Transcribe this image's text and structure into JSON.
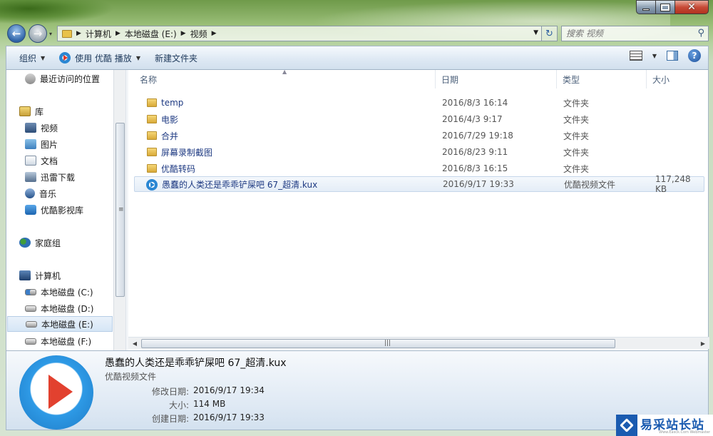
{
  "window": {
    "caption_buttons": [
      "minimize",
      "maximize",
      "close"
    ]
  },
  "address": {
    "crumbs": [
      "计算机",
      "本地磁盘 (E:)",
      "视频"
    ],
    "search_placeholder": "搜索 视频"
  },
  "toolbar": {
    "organize": "组织",
    "play": "使用 优酷 播放",
    "new_folder": "新建文件夹"
  },
  "nav": {
    "recent": "最近访问的位置",
    "library": "库",
    "lib_items": [
      "视频",
      "图片",
      "文档",
      "迅雷下载",
      "音乐",
      "优酷影视库"
    ],
    "homegroup": "家庭组",
    "computer": "计算机",
    "drives": [
      "本地磁盘 (C:)",
      "本地磁盘 (D:)",
      "本地磁盘 (E:)",
      "本地磁盘 (F:)"
    ],
    "selected_drive": "本地磁盘 (E:)"
  },
  "columns": {
    "name": "名称",
    "date": "日期",
    "type": "类型",
    "size": "大小"
  },
  "files": [
    {
      "name": "temp",
      "date": "2016/8/3 16:14",
      "type": "文件夹",
      "size": "",
      "icon": "folder-icon"
    },
    {
      "name": "电影",
      "date": "2016/4/3 9:17",
      "type": "文件夹",
      "size": "",
      "icon": "folder-icon"
    },
    {
      "name": "合并",
      "date": "2016/7/29 19:18",
      "type": "文件夹",
      "size": "",
      "icon": "folder-icon"
    },
    {
      "name": "屏幕录制截图",
      "date": "2016/8/23 9:11",
      "type": "文件夹",
      "size": "",
      "icon": "folder-icon"
    },
    {
      "name": "优酷转码",
      "date": "2016/8/3 16:15",
      "type": "文件夹",
      "size": "",
      "icon": "folder-icon"
    },
    {
      "name": "愚蠢的人类还是乖乖铲屎吧 67_超清.kux",
      "date": "2016/9/17 19:33",
      "type": "优酷视频文件",
      "size": "117,248 KB",
      "icon": "youku-file-icon",
      "selected": true
    }
  ],
  "details": {
    "title": "愚蠢的人类还是乖乖铲屎吧 67_超清.kux",
    "type": "优酷视频文件",
    "modified_label": "修改日期:",
    "modified": "2016/9/17 19:34",
    "size_label": "大小:",
    "size": "114 MB",
    "created_label": "创建日期:",
    "created": "2016/9/17 19:33"
  },
  "watermark": {
    "text": "易采站长站",
    "sub": "Www.Easck.Com Webmaster"
  }
}
